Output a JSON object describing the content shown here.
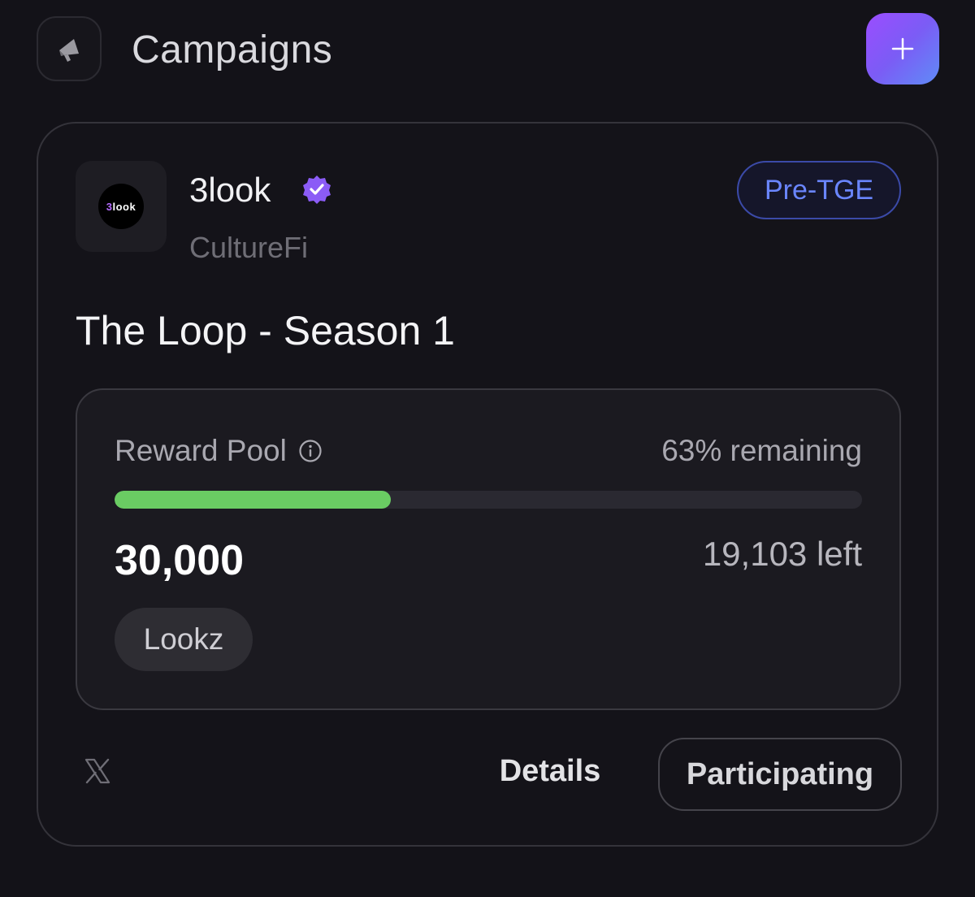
{
  "header": {
    "title": "Campaigns",
    "megaphone_icon": "megaphone-icon",
    "add_icon": "plus-icon"
  },
  "campaign": {
    "brand": {
      "logo_text_prefix": "3",
      "logo_text_rest": "look",
      "name": "3look",
      "verified_icon": "verified-badge-icon",
      "category": "CultureFi"
    },
    "badge": "Pre-TGE",
    "title": "The Loop - Season 1",
    "reward_pool": {
      "label": "Reward Pool",
      "info_icon": "info-icon",
      "remaining_text": "63% remaining",
      "progress_fraction": 0.37,
      "total": "30,000",
      "left_text": "19,103 left",
      "token": "Lookz"
    },
    "footer": {
      "x_icon": "x-logo-icon",
      "details_label": "Details",
      "participating_label": "Participating"
    }
  },
  "colors": {
    "background": "#131218",
    "progress_fill": "#6acc63",
    "badge_accent": "#6a86ff",
    "verified": "#8b5cf6",
    "add_gradient_start": "#9b4dff",
    "add_gradient_end": "#5f8cf7"
  }
}
